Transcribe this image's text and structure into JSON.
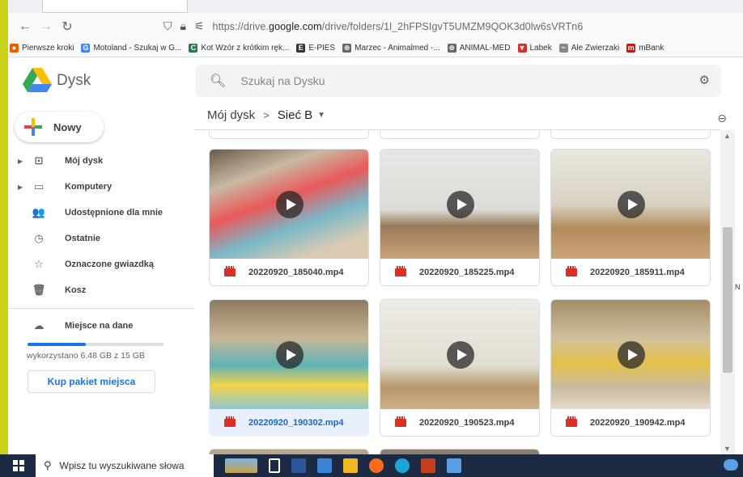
{
  "browser": {
    "url_prefix": "https://drive.",
    "url_domain": "google.com",
    "url_path": "/drive/folders/1l_2hFPSIgvT5UMZM9QOK3d0lw6sVRTn6",
    "bookmarks": [
      {
        "label": "Pierwsze kroki",
        "color": "#e66000",
        "glyph": "●"
      },
      {
        "label": "Motoland - Szukaj w G...",
        "color": "#4285f4",
        "glyph": "G"
      },
      {
        "label": "Kot Wzór z krótkim ręk...",
        "color": "#2b7a4b",
        "glyph": "C"
      },
      {
        "label": "E-PIES",
        "color": "#333333",
        "glyph": "E"
      },
      {
        "label": "Marzec - Animalmed -...",
        "color": "#666666",
        "glyph": "⊕"
      },
      {
        "label": "ANIMAL-MED",
        "color": "#666666",
        "glyph": "⊕"
      },
      {
        "label": "Labek",
        "color": "#d32f2f",
        "glyph": "▼"
      },
      {
        "label": "Ale Zwierzaki",
        "color": "#888888",
        "glyph": "~"
      },
      {
        "label": "mBank",
        "color": "#b71c1c",
        "glyph": "m"
      }
    ]
  },
  "header": {
    "app_name": "Dysk",
    "search_placeholder": "Szukaj na Dysku"
  },
  "sidebar": {
    "new_label": "Nowy",
    "items": [
      {
        "label": "Mój dysk",
        "icon": "my-drive-icon",
        "glyph": "⊡",
        "expandable": true
      },
      {
        "label": "Komputery",
        "icon": "computer-icon",
        "glyph": "▭",
        "expandable": true
      },
      {
        "label": "Udostępnione dla mnie",
        "icon": "shared-icon",
        "glyph": "👥",
        "expandable": false
      },
      {
        "label": "Ostatnie",
        "icon": "clock-icon",
        "glyph": "◷",
        "expandable": false
      },
      {
        "label": "Oznaczone gwiazdką",
        "icon": "star-icon",
        "glyph": "☆",
        "expandable": false
      },
      {
        "label": "Kosz",
        "icon": "trash-icon",
        "glyph": "🗑",
        "expandable": false
      }
    ],
    "storage_label": "Miejsce na dane",
    "storage_used_fraction": 0.43,
    "storage_text": "wykorzystano 6,48 GB z 15 GB",
    "buy_label": "Kup pakiet miejsca"
  },
  "breadcrumb": {
    "root": "Mój dysk",
    "current": "Sieć B"
  },
  "files": [
    {
      "name": "20220920_185040.mp4",
      "selected": false,
      "scene": "blur"
    },
    {
      "name": "20220920_185225.mp4",
      "selected": false,
      "scene": "projector"
    },
    {
      "name": "20220920_185911.mp4",
      "selected": false,
      "scene": "room"
    },
    {
      "name": "20220920_190302.mp4",
      "selected": true,
      "scene": "mat"
    },
    {
      "name": "20220920_190523.mp4",
      "selected": false,
      "scene": "wall"
    },
    {
      "name": "20220920_190942.mp4",
      "selected": false,
      "scene": "mat2"
    }
  ],
  "right_edge_letter": "N",
  "taskbar": {
    "search_placeholder": "Wpisz tu wyszukiwane słowa"
  }
}
